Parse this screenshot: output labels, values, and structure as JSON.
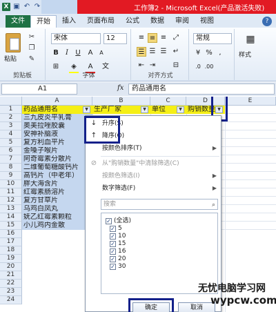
{
  "title": {
    "text": "工作簿2 - Microsoft Excel(产品激活失败)",
    "qa_icons": [
      "excel-icon",
      "save-icon",
      "undo-icon",
      "redo-icon"
    ]
  },
  "tabs": {
    "file": "文件",
    "items": [
      "开始",
      "插入",
      "页面布局",
      "公式",
      "数据",
      "审阅",
      "视图"
    ],
    "active": "开始"
  },
  "ribbon": {
    "paste": "粘贴",
    "clipboard_label": "剪贴板",
    "font_name": "宋体",
    "font_size": "12",
    "font_label": "字体",
    "bold": "B",
    "italic": "I",
    "underline": "U",
    "align_label": "对齐方式",
    "number_format": "常规",
    "number_symbols": [
      "%",
      ","
    ],
    "style_label": "样式",
    "font_color": "#e02020",
    "fill_color": "#ffff00"
  },
  "formula_bar": {
    "name_box": "A1",
    "fx": "fx",
    "content": "药品通用名"
  },
  "columns": [
    "A",
    "B",
    "C",
    "D",
    "E"
  ],
  "rows": [
    "1",
    "2",
    "3",
    "4",
    "5",
    "6",
    "7",
    "8",
    "9",
    "10",
    "11",
    "12",
    "13",
    "14",
    "15",
    "16",
    "17",
    "18",
    "19",
    "20",
    "21",
    "22",
    "23",
    "24"
  ],
  "headers": [
    "药品通用名",
    "生产厂家",
    "单位",
    "购销数量"
  ],
  "drugs": [
    "三九皮炎平乳膏",
    "奥美拉唑胶囊",
    "安神补脑液",
    "复方利血平片",
    "金嗓子喉片",
    "阿奇霉素分散片",
    "二维葡萄糖酸钙片",
    "高钙片（中老年）",
    "胖大海含片",
    "红霉素肠溶片",
    "复方甘草片",
    "乌鸡白凤丸",
    "妩乙红霉素颗粒",
    "小儿鸡内金散"
  ],
  "menu": {
    "sort_asc": "升序(S)",
    "sort_desc": "降序(O)",
    "sort_by_color": "按颜色排序(T)",
    "clear_filter": "从\"购销数量\"中清除筛选(C)",
    "filter_by_color": "按颜色筛选(I)",
    "number_filter": "数字筛选(F)",
    "search_placeholder": "搜索",
    "list": [
      "(全选)",
      "5",
      "10",
      "15",
      "16",
      "20",
      "30"
    ],
    "ok": "确定",
    "cancel": "取消"
  },
  "watermark": {
    "line1": "无忧电脑学习网",
    "line2": "wypcw.com"
  }
}
